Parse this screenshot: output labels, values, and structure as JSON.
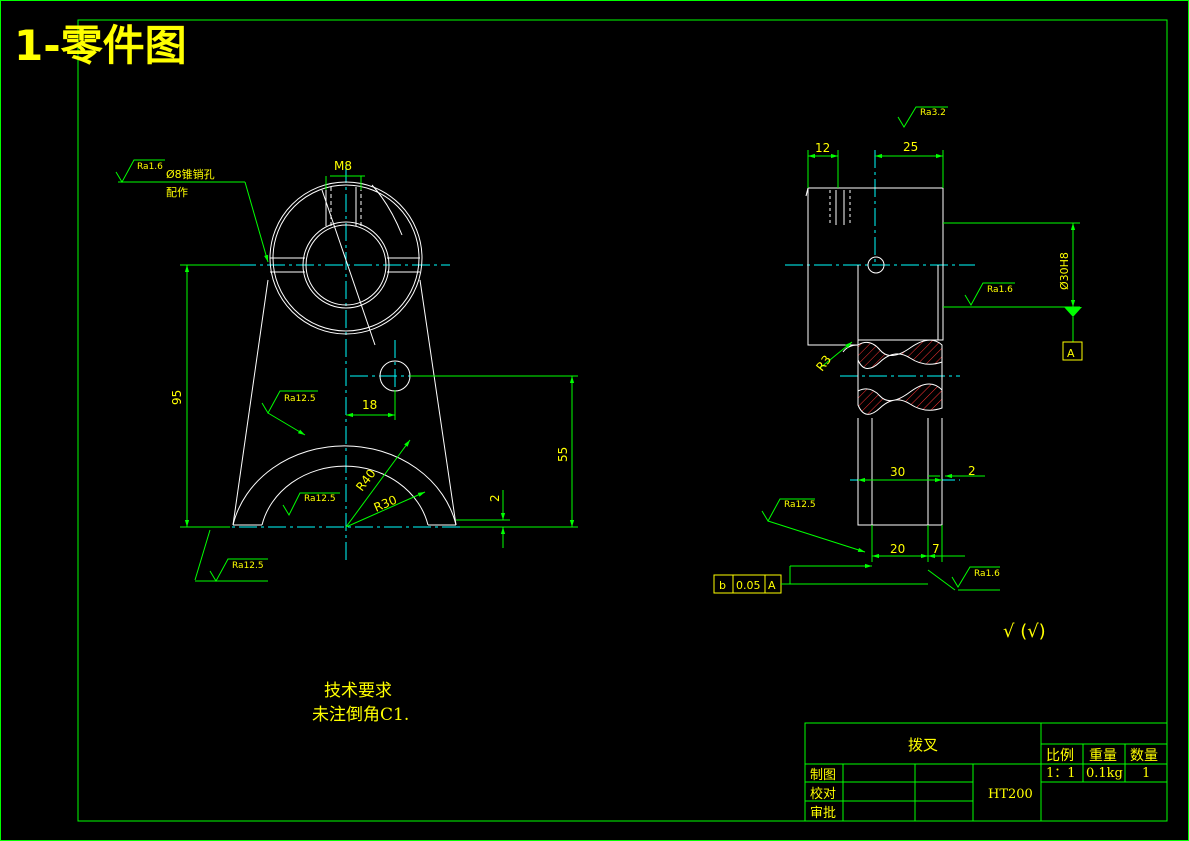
{
  "title": "1-零件图",
  "front_view": {
    "pin_hole_label": "Ø8锥销孔",
    "pin_hole_note": "配作",
    "thread": "M8",
    "ra_hole": "Ra1.6",
    "ra_arc": "Ra12.5",
    "ra_inner": "Ra12.5",
    "ra_base": "Ra12.5",
    "dim_height": "95",
    "dim_offset": "18",
    "dim_hole_height": "55",
    "dim_base_step": "2",
    "radius_outer": "R40",
    "radius_inner": "R30"
  },
  "side_view": {
    "ra_top": "Ra3.2",
    "ra_bore": "Ra1.6",
    "ra_fork": "Ra12.5",
    "ra_side": "Ra1.6",
    "dim_12": "12",
    "dim_25": "25",
    "bore": "Ø30H8",
    "datum": "A",
    "fillet": "R3",
    "dim_30": "30",
    "dim_2": "2",
    "dim_20": "20",
    "dim_7": "7",
    "tol_symbol": "b",
    "tol_value": "0.05",
    "tol_datum": "A",
    "general_roughness": "√ (√)"
  },
  "notes": {
    "heading": "技术要求",
    "line1": "未注倒角C1."
  },
  "title_block": {
    "part_name": "拨叉",
    "col_scale": "比例",
    "col_weight": "重量",
    "col_qty": "数量",
    "scale": "1：1",
    "weight": "0.1kg",
    "qty": "1",
    "drawn": "制图",
    "checked": "校对",
    "approved": "审批",
    "material": "HT200"
  },
  "colors": {
    "outline": "#ffffff",
    "dimension": "#00ff00",
    "centerline": "#00ffff",
    "text": "#ffff00",
    "hatch": "#ff3333"
  }
}
